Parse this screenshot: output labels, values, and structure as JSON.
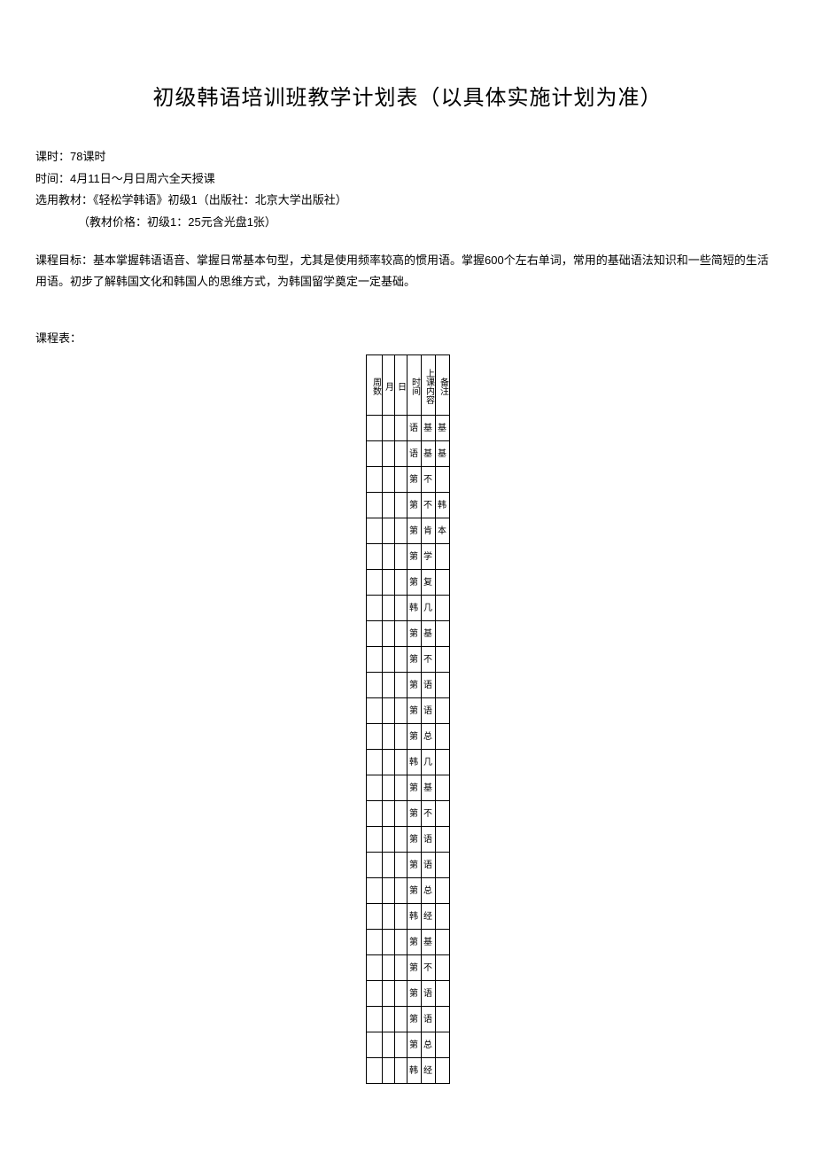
{
  "title": "初级韩语培训班教学计划表（以具体实施计划为准）",
  "info": {
    "hours": "课时：78课时",
    "time": "时间：4月11日～月日周六全天授课",
    "textbook": "选用教材：《轻松学韩语》初级1（出版社：北京大学出版社）",
    "price": "（教材价格：初级1：25元含光盘1张）"
  },
  "goal": "课程目标：基本掌握韩语语音、掌握日常基本句型，尤其是使用频率较高的惯用语。掌握600个左右单词，常用的基础语法知识和一些简短的生活用语。初步了解韩国文化和韩国人的思维方式，为韩国留学奠定一定基础。",
  "schedule_label": "课程表：",
  "table": {
    "headers": [
      "周数",
      "月",
      "日",
      "时间",
      "上课内容",
      "备注"
    ],
    "rows": [
      [
        "",
        "",
        "",
        "语",
        "基",
        "基"
      ],
      [
        "",
        "",
        "",
        "语",
        "基",
        "基"
      ],
      [
        "",
        "",
        "",
        "第",
        "不",
        ""
      ],
      [
        "",
        "",
        "",
        "第",
        "不",
        "韩"
      ],
      [
        "",
        "",
        "",
        "第",
        "肯",
        "本"
      ],
      [
        "",
        "",
        "",
        "第",
        "学",
        ""
      ],
      [
        "",
        "",
        "",
        "第",
        "复",
        ""
      ],
      [
        "",
        "",
        "",
        "韩",
        "几",
        ""
      ],
      [
        "",
        "",
        "",
        "第",
        "基",
        ""
      ],
      [
        "",
        "",
        "",
        "第",
        "不",
        ""
      ],
      [
        "",
        "",
        "",
        "第",
        "语",
        ""
      ],
      [
        "",
        "",
        "",
        "第",
        "语",
        ""
      ],
      [
        "",
        "",
        "",
        "第",
        "总",
        ""
      ],
      [
        "",
        "",
        "",
        "韩",
        "几",
        ""
      ],
      [
        "",
        "",
        "",
        "第",
        "基",
        ""
      ],
      [
        "",
        "",
        "",
        "第",
        "不",
        ""
      ],
      [
        "",
        "",
        "",
        "第",
        "语",
        ""
      ],
      [
        "",
        "",
        "",
        "第",
        "语",
        ""
      ],
      [
        "",
        "",
        "",
        "第",
        "总",
        ""
      ],
      [
        "",
        "",
        "",
        "韩",
        "经",
        ""
      ],
      [
        "",
        "",
        "",
        "第",
        "基",
        ""
      ],
      [
        "",
        "",
        "",
        "第",
        "不",
        ""
      ],
      [
        "",
        "",
        "",
        "第",
        "语",
        ""
      ],
      [
        "",
        "",
        "",
        "第",
        "语",
        ""
      ],
      [
        "",
        "",
        "",
        "第",
        "总",
        ""
      ],
      [
        "",
        "",
        "",
        "韩",
        "经",
        ""
      ]
    ]
  }
}
